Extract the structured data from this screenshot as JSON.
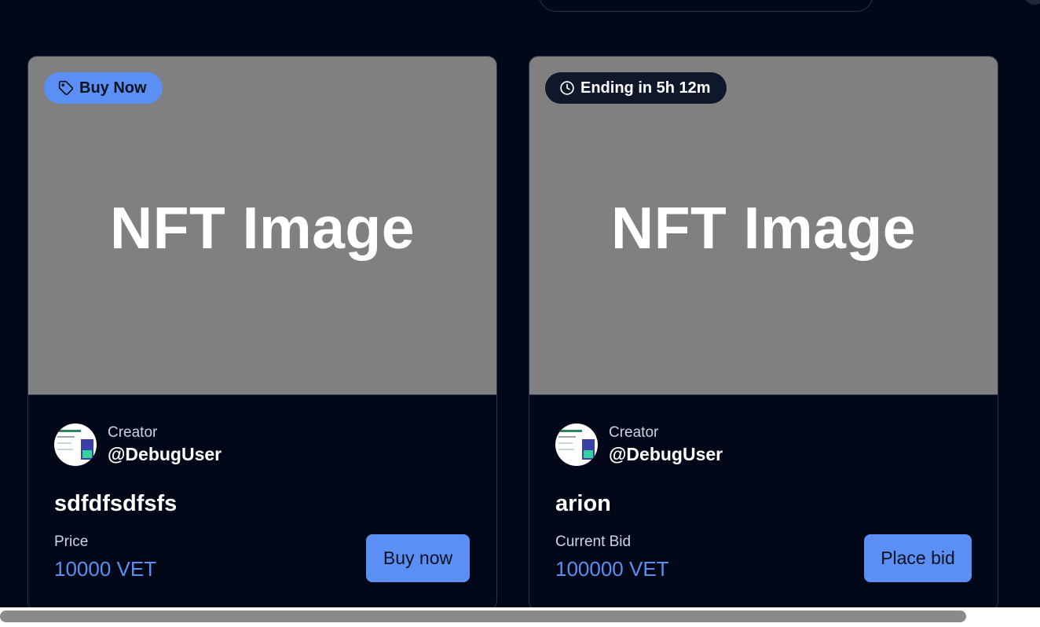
{
  "theme": {
    "background": "#020817",
    "accent": "#5b8ff3",
    "border": "#2a3447",
    "placeholder": "#808080"
  },
  "cards": [
    {
      "badge_icon": "tag-icon",
      "badge": "Buy Now",
      "image_placeholder": "NFT Image",
      "creator_label": "Creator",
      "creator_handle": "@DebugUser",
      "title": "sdfdfsdfsfs",
      "price_label": "Price",
      "price_value": "10000 VET",
      "action": "Buy now"
    },
    {
      "badge_icon": "clock-icon",
      "badge": "Ending in 5h 12m",
      "image_placeholder": "NFT Image",
      "creator_label": "Creator",
      "creator_handle": "@DebugUser",
      "title": "arion",
      "price_label": "Current Bid",
      "price_value": "100000 VET",
      "action": "Place bid"
    }
  ]
}
